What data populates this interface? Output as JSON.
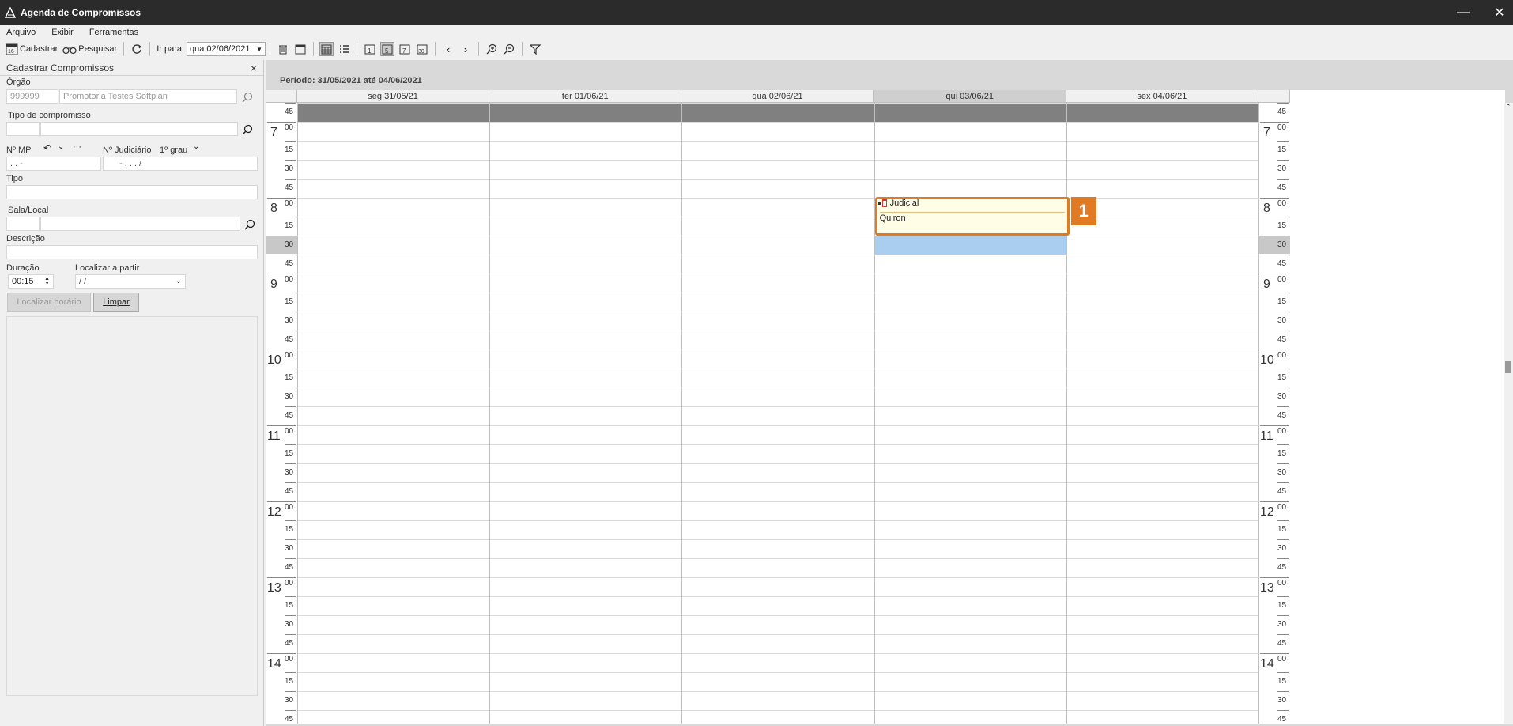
{
  "window": {
    "title": "Agenda de Compromissos",
    "minimize": "—",
    "close": "✕"
  },
  "menu": {
    "items": [
      "Arquivo",
      "Exibir",
      "Ferramentas"
    ]
  },
  "toolbar": {
    "cadastrar": "Cadastrar",
    "pesquisar": "Pesquisar",
    "ir_para": "Ir para",
    "date_value": "qua 02/06/2021"
  },
  "left_panel": {
    "title": "Cadastrar Compromissos",
    "close": "×",
    "orgao_label": "Órgão",
    "orgao_code": "999999",
    "orgao_name": "Promotoria Testes Softplan",
    "tipo_compromisso_label": "Tipo de compromisso",
    "nmp_label": "Nº MP",
    "nmp_value": ".       .          -",
    "njudiciario_label": "Nº Judiciário",
    "grau_label": "1º grau",
    "njudiciario_value": "-   .      .   .      /",
    "tipo_label": "Tipo",
    "sala_label": "Sala/Local",
    "descricao_label": "Descrição",
    "duracao_label": "Duração",
    "duracao_value": "00:15",
    "localizar_partir_label": "Localizar a partir",
    "localizar_partir_value": " / /",
    "localizar_button": "Localizar horário",
    "limpar_button": "Limpar"
  },
  "calendar": {
    "period": "Período: 31/05/2021 até 04/06/2021",
    "days": [
      "seg 31/05/21",
      "ter 01/06/21",
      "qua 02/06/21",
      "qui 03/06/21",
      "sex 04/06/21"
    ],
    "today_index": 3,
    "time_rows": [
      {
        "hour": "",
        "min": "45"
      },
      {
        "hour": "7",
        "min": "00"
      },
      {
        "hour": "",
        "min": "15"
      },
      {
        "hour": "",
        "min": "30"
      },
      {
        "hour": "",
        "min": "45"
      },
      {
        "hour": "8",
        "min": "00"
      },
      {
        "hour": "",
        "min": "15"
      },
      {
        "hour": "",
        "min": "30"
      },
      {
        "hour": "",
        "min": "45"
      },
      {
        "hour": "9",
        "min": "00"
      },
      {
        "hour": "",
        "min": "15"
      },
      {
        "hour": "",
        "min": "30"
      },
      {
        "hour": "",
        "min": "45"
      },
      {
        "hour": "10",
        "min": "00"
      },
      {
        "hour": "",
        "min": "15"
      },
      {
        "hour": "",
        "min": "30"
      },
      {
        "hour": "",
        "min": "45"
      },
      {
        "hour": "11",
        "min": "00"
      },
      {
        "hour": "",
        "min": "15"
      },
      {
        "hour": "",
        "min": "30"
      },
      {
        "hour": "",
        "min": "45"
      },
      {
        "hour": "12",
        "min": "00"
      },
      {
        "hour": "",
        "min": "15"
      },
      {
        "hour": "",
        "min": "30"
      },
      {
        "hour": "",
        "min": "45"
      },
      {
        "hour": "13",
        "min": "00"
      },
      {
        "hour": "",
        "min": "15"
      },
      {
        "hour": "",
        "min": "30"
      },
      {
        "hour": "",
        "min": "45"
      },
      {
        "hour": "14",
        "min": "00"
      },
      {
        "hour": "",
        "min": "15"
      },
      {
        "hour": "",
        "min": "30"
      },
      {
        "hour": "",
        "min": "45"
      }
    ],
    "event": {
      "type": "Judicial",
      "title": "Quiron",
      "badge": "1"
    },
    "colors": {
      "header_band": "#808080",
      "selected_slot": "#a9cef0",
      "event_bg": "#fffde6",
      "badge": "#e07b24"
    }
  }
}
